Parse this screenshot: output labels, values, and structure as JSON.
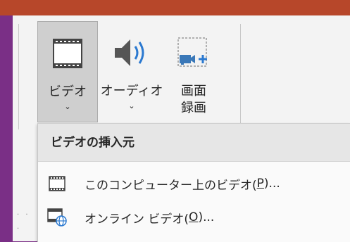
{
  "ribbon": {
    "video": {
      "label": "ビデオ",
      "chevron": "⌄"
    },
    "audio": {
      "label": "オーディオ",
      "chevron": "⌄"
    },
    "screen_recording": {
      "label_line1": "画面",
      "label_line2": "録画"
    }
  },
  "menu": {
    "header": "ビデオの挿入元",
    "items": [
      {
        "label": "このコンピューター上のビデオ(",
        "accel": "P",
        "suffix": ")...",
        "icon": "film-icon"
      },
      {
        "label": "オンライン ビデオ(",
        "accel": "O",
        "suffix": ")...",
        "icon": "online-video-icon"
      }
    ]
  },
  "colors": {
    "title_bar": "#b7472a",
    "window_frame": "#7a2f86",
    "ribbon_bg": "#f3f3f3",
    "pressed_button": "#cfcfcf",
    "accent_blue": "#2b79d0"
  }
}
